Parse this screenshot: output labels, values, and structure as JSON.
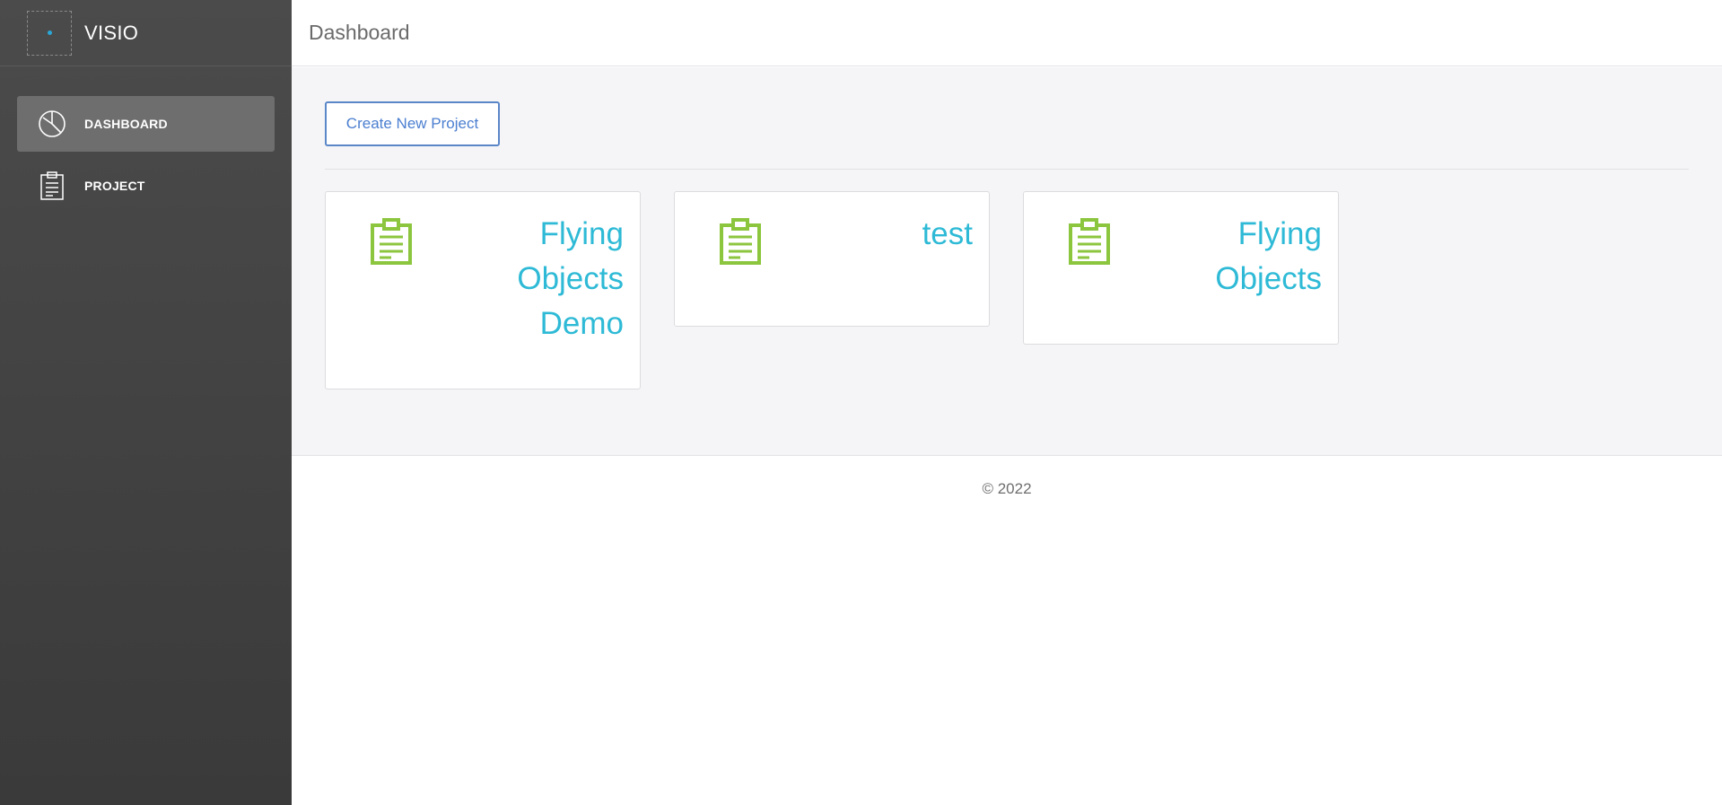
{
  "brand": {
    "name": "VISIO",
    "logo_icon": "app-logo-icon"
  },
  "sidebar": {
    "items": [
      {
        "label": "DASHBOARD",
        "icon": "pie-chart-icon",
        "active": true
      },
      {
        "label": "PROJECT",
        "icon": "clipboard-icon",
        "active": false
      }
    ]
  },
  "header": {
    "title": "Dashboard"
  },
  "main": {
    "create_button_label": "Create New Project",
    "projects": [
      {
        "title": "Flying Objects Demo",
        "icon": "clipboard-icon"
      },
      {
        "title": "test",
        "icon": "clipboard-icon"
      },
      {
        "title": "Flying Objects",
        "icon": "clipboard-icon"
      }
    ]
  },
  "footer": {
    "text": "© 2022"
  },
  "colors": {
    "sidebar_bg": "#444444",
    "active_item_bg": "#6e6e6e",
    "accent_blue": "#4b7fd0",
    "card_title": "#2ebad6",
    "card_icon": "#8cc63f",
    "content_bg": "#f5f5f7"
  }
}
